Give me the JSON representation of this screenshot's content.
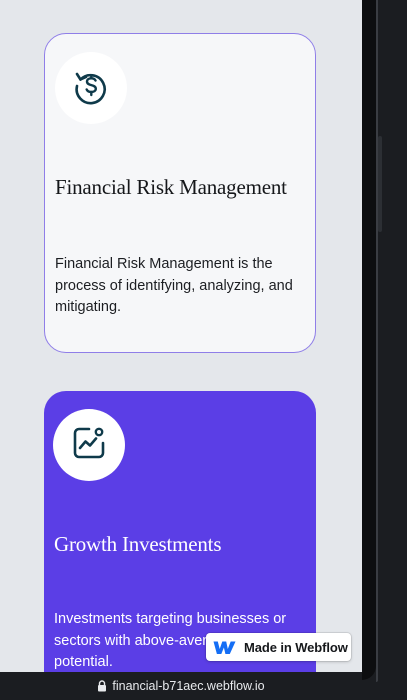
{
  "cards": [
    {
      "icon": "dollar-refresh-icon",
      "title": "Financial Risk Management",
      "description": "Financial Risk Management is the process of identifying, analyzing, and mitigating."
    },
    {
      "icon": "growth-chart-icon",
      "title": "Growth Investments",
      "description": "Investments targeting businesses or sectors with above-average growth potential."
    }
  ],
  "badge": {
    "label": "Made in Webflow",
    "icon": "webflow-logo-icon"
  },
  "urlbar": {
    "url": "financial-b71aec.webflow.io",
    "icon": "lock-icon"
  },
  "colors": {
    "accent": "#5b3ee6",
    "card_border": "#8f7ee8",
    "icon_stroke": "#0f3a4a"
  }
}
